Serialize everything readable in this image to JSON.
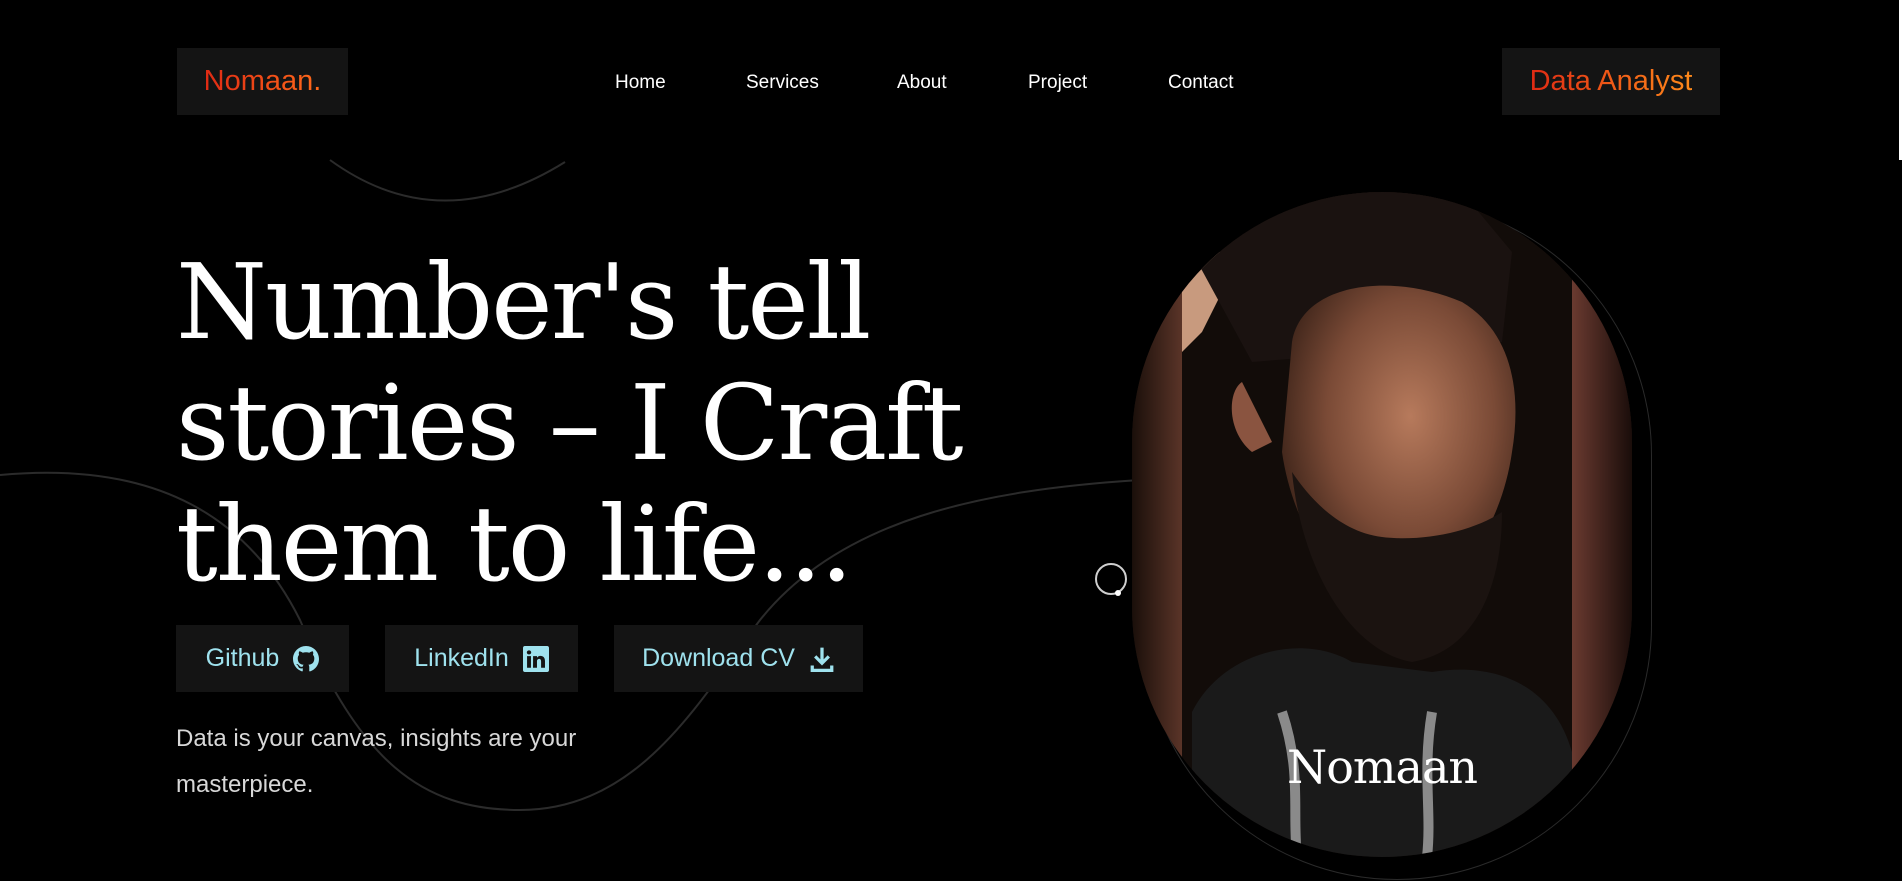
{
  "brand": {
    "logo": "Nomaan.",
    "role": "Data Analyst"
  },
  "nav": [
    {
      "label": "Home"
    },
    {
      "label": "Services"
    },
    {
      "label": "About"
    },
    {
      "label": "Project"
    },
    {
      "label": "Contact"
    }
  ],
  "hero": {
    "headline": "Number's tell stories – I Craft them to life...",
    "tagline": "Data is your canvas, insights are your masterpiece."
  },
  "buttons": {
    "github": {
      "label": "Github",
      "icon": "github-icon"
    },
    "linkedin": {
      "label": "LinkedIn",
      "icon": "linkedin-icon"
    },
    "download": {
      "label": "Download CV",
      "icon": "download-icon"
    }
  },
  "portrait": {
    "name": "Nomaan"
  },
  "colors": {
    "background": "#000000",
    "panel": "#141414",
    "accent_start": "#e02a14",
    "accent_end": "#ff6a1a",
    "button_text": "#9fe2ee"
  }
}
